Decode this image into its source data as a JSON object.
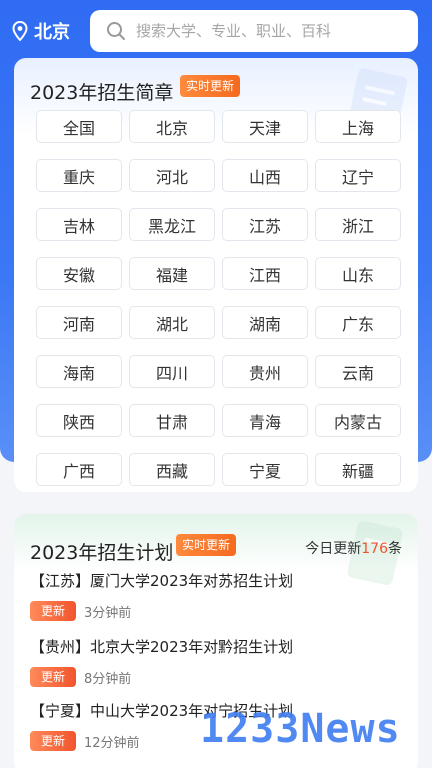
{
  "header": {
    "location": "北京",
    "search_placeholder": "搜索大学、专业、职业、百科"
  },
  "brochure": {
    "title": "2023年招生简章",
    "badge": "实时更新",
    "provinces": [
      "全国",
      "北京",
      "天津",
      "上海",
      "重庆",
      "河北",
      "山西",
      "辽宁",
      "吉林",
      "黑龙江",
      "江苏",
      "浙江",
      "安徽",
      "福建",
      "江西",
      "山东",
      "河南",
      "湖北",
      "湖南",
      "广东",
      "海南",
      "四川",
      "贵州",
      "云南",
      "陕西",
      "甘肃",
      "青海",
      "内蒙古",
      "广西",
      "西藏",
      "宁夏",
      "新疆"
    ]
  },
  "plan": {
    "title": "2023年招生计划",
    "badge": "实时更新",
    "today_prefix": "今日更新",
    "today_count": "176",
    "today_suffix": "条",
    "items": [
      {
        "title": "【江苏】厦门大学2023年对苏招生计划",
        "tag": "更新",
        "time": "3分钟前"
      },
      {
        "title": "【贵州】北京大学2023年对黔招生计划",
        "tag": "更新",
        "time": "8分钟前"
      },
      {
        "title": "【宁夏】中山大学2023年对宁招生计划",
        "tag": "更新",
        "time": "12分钟前"
      }
    ]
  },
  "watermark": "1233News",
  "colors": {
    "primary": "#2f6cf3",
    "badge": "#f56a1e",
    "accent_num": "#f2542d"
  }
}
